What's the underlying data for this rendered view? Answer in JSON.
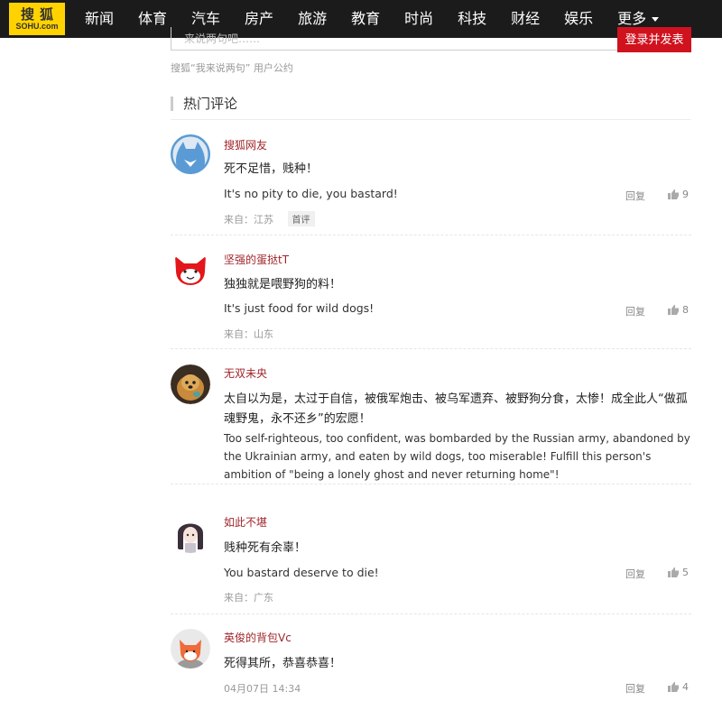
{
  "logo": {
    "cn": "搜狐",
    "en": "SOHU.com"
  },
  "nav": {
    "items": [
      "新闻",
      "体育",
      "汽车",
      "房产",
      "旅游",
      "教育",
      "时尚",
      "科技",
      "财经",
      "娱乐"
    ],
    "more": "更多"
  },
  "comment_box": {
    "placeholder": "来说两句吧……",
    "submit": "登录并发表",
    "agreement": "搜狐“我来说两句” 用户公约"
  },
  "section": {
    "title": "热门评论"
  },
  "comments": [
    {
      "user": "搜狐网友",
      "text": "死不足惜，贱种！",
      "translation": "It's no pity to die, you bastard!",
      "location": "来自：江苏",
      "badge": "首评",
      "reply": "回复",
      "likes": "9"
    },
    {
      "user": "坚强的蛋挞tT",
      "text": "独独就是喂野狗的料！",
      "translation": "It's just food for wild dogs!",
      "location": "来自：山东",
      "reply": "回复",
      "likes": "8"
    },
    {
      "user": "无双未央",
      "text": "太自以为是，太过于自信，被俄军炮击、被乌军遗弃、被野狗分食，太惨！成全此人“做孤魂野鬼，永不还乡”的宏愿！",
      "translation": "Too self-righteous, too confident, was bombarded by the Russian army, abandoned by the Ukrainian army, and eaten by wild dogs, too miserable! Fulfill this person's ambition of \"being a lonely ghost and never returning home\"!"
    },
    {
      "user": "如此不堪",
      "text": "贱种死有余辜！",
      "translation": "You bastard deserve to die!",
      "location": "来自：广东",
      "reply": "回复",
      "likes": "5"
    },
    {
      "user": "英俊的背包Vc",
      "text": "死得其所，恭喜恭喜！",
      "time": "04月07日 14:34",
      "reply": "回复",
      "likes": "4"
    }
  ],
  "colors": {
    "topbar": "#1b1b1b",
    "logo": "#ffd200",
    "accent": "#d0121e",
    "username": "#a1252a"
  }
}
